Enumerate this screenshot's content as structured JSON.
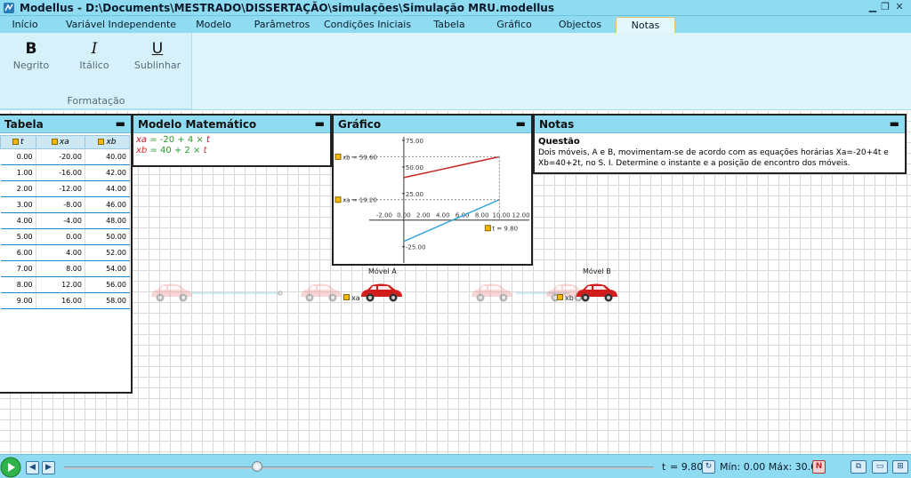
{
  "window": {
    "title": "Modellus - D:\\Documents\\MESTRADO\\DISSERTAÇÃO\\simulações\\Simulação MRU.modellus"
  },
  "ribbon_tabs": [
    {
      "label": "Início",
      "active": false
    },
    {
      "label": "Variável Independente",
      "active": false
    },
    {
      "label": "Modelo",
      "active": false
    },
    {
      "label": "Parâmetros",
      "active": false
    },
    {
      "label": "Condições Iniciais",
      "active": false
    },
    {
      "label": "Tabela",
      "active": false
    },
    {
      "label": "Gráfico",
      "active": false
    },
    {
      "label": "Objectos",
      "active": false
    },
    {
      "label": "Notas",
      "active": true
    }
  ],
  "format_group": {
    "buttons": [
      {
        "glyph": "B",
        "label": "Negrito"
      },
      {
        "glyph": "I",
        "label": "Itálico"
      },
      {
        "glyph": "U",
        "label": "Sublinhar"
      }
    ],
    "label": "Formatação"
  },
  "tabela": {
    "title": "Tabela",
    "columns": [
      "t",
      "xa",
      "xb"
    ],
    "rows": [
      [
        "0.00",
        "-20.00",
        "40.00"
      ],
      [
        "1.00",
        "-16.00",
        "42.00"
      ],
      [
        "2.00",
        "-12.00",
        "44.00"
      ],
      [
        "3.00",
        "-8.00",
        "46.00"
      ],
      [
        "4.00",
        "-4.00",
        "48.00"
      ],
      [
        "5.00",
        "0.00",
        "50.00"
      ],
      [
        "6.00",
        "4.00",
        "52.00"
      ],
      [
        "7.00",
        "8.00",
        "54.00"
      ],
      [
        "8.00",
        "12.00",
        "56.00"
      ],
      [
        "9.00",
        "16.00",
        "58.00"
      ]
    ]
  },
  "modelo": {
    "title": "Modelo Matemático",
    "equations": [
      {
        "var": "xa",
        "eq": " = -20 + 4 × ",
        "ind": "t"
      },
      {
        "var": "xb",
        "eq": " = 40 + 2 × ",
        "ind": "t"
      }
    ],
    "colors": {
      "xa": "#c8102e",
      "xb": "#d62f2f",
      "number": "#2a9a2a"
    }
  },
  "grafico": {
    "title": "Gráfico",
    "labels": {
      "xb": "xb = 59.60",
      "xa": "xa = 19.20",
      "t": "t = 9.80"
    }
  },
  "chart_data": {
    "type": "line",
    "x": [
      0,
      9.8
    ],
    "series": [
      {
        "name": "xa",
        "values": [
          -20,
          19.2
        ],
        "color": "#35a8dc"
      },
      {
        "name": "xb",
        "values": [
          40,
          59.6
        ],
        "color": "#c62828"
      }
    ],
    "x_ticks": [
      "-2.00",
      "0.00",
      "2.00",
      "4.00",
      "6.00",
      "8.00",
      "10.00",
      "12.00"
    ],
    "y_ticks": [
      "75.00",
      "50.00",
      "25.00",
      "-25.00"
    ],
    "xlim": [
      -3,
      12.5
    ],
    "ylim": [
      -32,
      80
    ]
  },
  "notas": {
    "title": "Notas",
    "heading": "Questão",
    "text": "Dois móveis, A e B, movimentam-se de acordo com as equações horárias Xa=-20+4t e Xb=40+2t, no S. I. Determine o instante e a posição de encontro dos móveis."
  },
  "objects": {
    "movel_a": "Móvel A",
    "movel_b": "Móvel B",
    "xa_tag": "xa",
    "xb_tag": "xb"
  },
  "bottom": {
    "t_label": "t",
    "t_value": "= 9.80",
    "range": "Mín: 0.00 Máx: 30.00",
    "progress": 0.327
  }
}
